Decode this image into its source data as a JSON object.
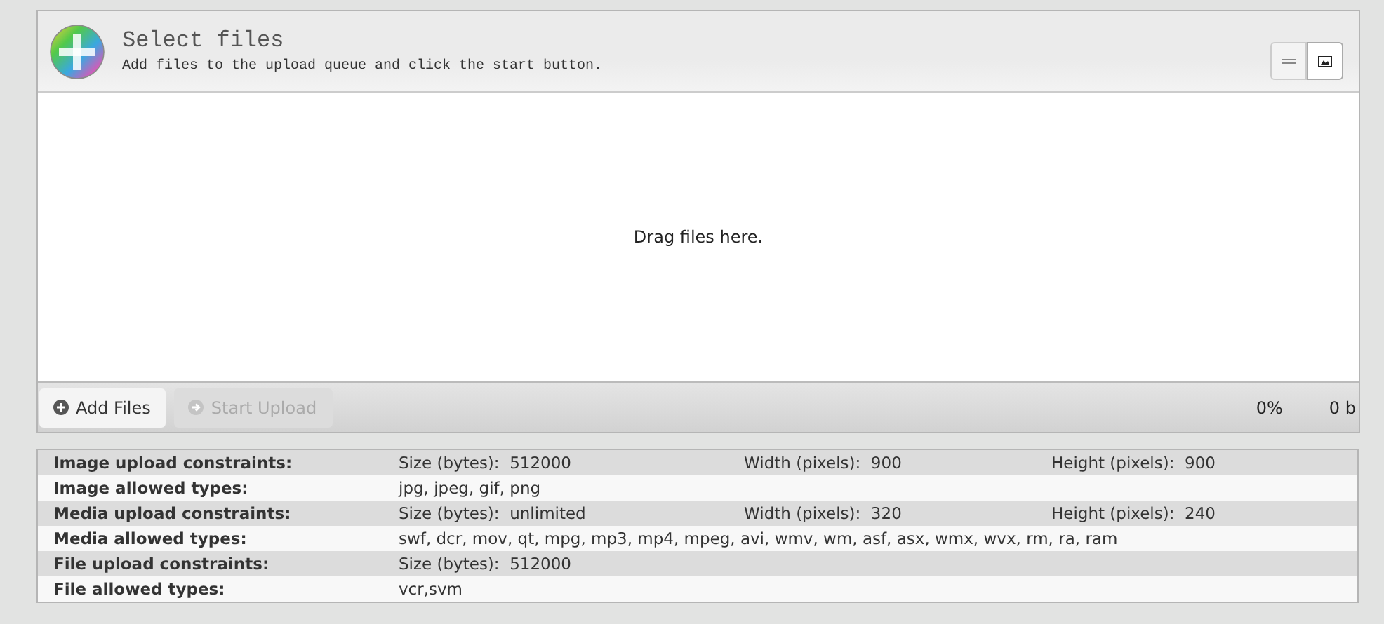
{
  "uploader": {
    "title": "Select files",
    "subtitle": "Add files to the upload queue and click the start button.",
    "view_buttons": [
      {
        "kind": "list",
        "selected": false
      },
      {
        "kind": "thumbs",
        "selected": true
      }
    ],
    "drop_text": "Drag files here.",
    "buttons": [
      {
        "label": "Add Files",
        "kind": "add",
        "disabled": false
      },
      {
        "label": "Start Upload",
        "kind": "start",
        "disabled": true
      }
    ],
    "percent": "0%",
    "size": "0 b"
  },
  "constraints": [
    {
      "label": "Image upload constraints:",
      "cells": [
        "Size (bytes):  512000",
        "Width (pixels):  900",
        "Height (pixels):  900"
      ]
    },
    {
      "label": "Image allowed types:",
      "cells": [
        "jpg, jpeg, gif, png"
      ]
    },
    {
      "label": "Media upload constraints:",
      "cells": [
        "Size (bytes):  unlimited",
        "Width (pixels):  320",
        "Height (pixels):  240"
      ]
    },
    {
      "label": "Media allowed types:",
      "cells": [
        "swf, dcr, mov, qt, mpg, mp3, mp4, mpeg, avi, wmv, wm, asf, asx, wmx, wvx, rm, ra, ram"
      ]
    },
    {
      "label": "File upload constraints:",
      "cells": [
        "Size (bytes):  512000"
      ]
    },
    {
      "label": "File allowed types:",
      "cells": [
        "vcr,svm"
      ]
    }
  ]
}
